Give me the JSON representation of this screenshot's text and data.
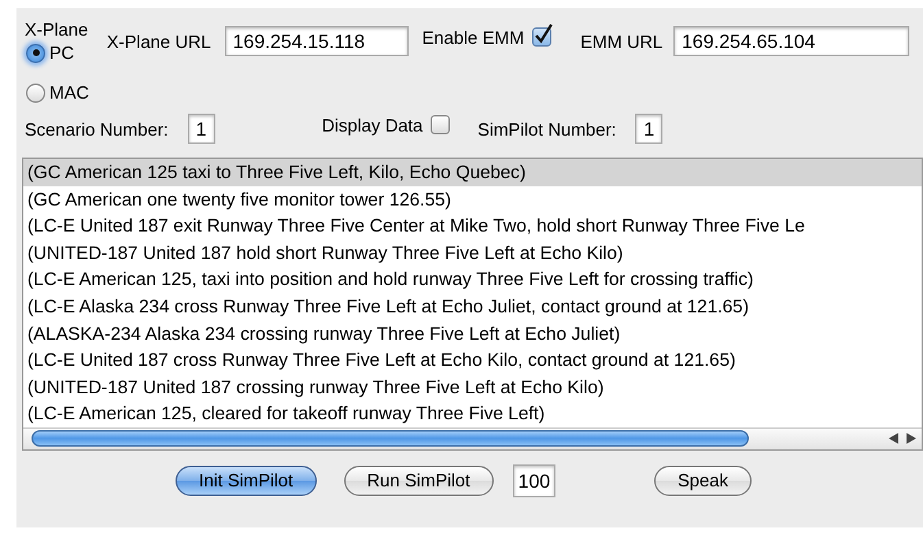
{
  "xplane": {
    "label": "X-Plane",
    "options": [
      {
        "label": "PC",
        "selected": true
      },
      {
        "label": "MAC",
        "selected": false
      }
    ]
  },
  "xplane_url": {
    "label": "X-Plane URL",
    "value": "169.254.15.118"
  },
  "enable_emm": {
    "label": "Enable EMM",
    "checked": true
  },
  "emm_url": {
    "label": "EMM URL",
    "value": "169.254.65.104"
  },
  "scenario_number": {
    "label": "Scenario Number:",
    "value": "1"
  },
  "display_data": {
    "label": "Display Data",
    "checked": false
  },
  "simpilot_number": {
    "label": "SimPilot Number:",
    "value": "1"
  },
  "list": {
    "items": [
      {
        "text": "(GC American 125 taxi to Three Five Left, Kilo, Echo Quebec)",
        "selected": true
      },
      {
        "text": "(GC American one twenty five monitor tower 126.55)",
        "selected": false
      },
      {
        "text": "(LC-E United 187 exit Runway Three Five Center at Mike Two, hold short Runway Three Five Le",
        "selected": false
      },
      {
        "text": "(UNITED-187 United 187 hold short Runway Three Five Left at Echo Kilo)",
        "selected": false
      },
      {
        "text": "(LC-E American 125, taxi into position and hold runway Three Five Left for crossing traffic)",
        "selected": false
      },
      {
        "text": "(LC-E Alaska 234 cross Runway Three Five Left at Echo Juliet, contact ground at 121.65)",
        "selected": false
      },
      {
        "text": "(ALASKA-234 Alaska 234 crossing runway Three Five Left at Echo Juliet)",
        "selected": false
      },
      {
        "text": "(LC-E United 187 cross Runway Three Five Left at Echo Kilo, contact ground at 121.65)",
        "selected": false
      },
      {
        "text": "(UNITED-187 United 187 crossing runway Three Five Left at Echo Kilo)",
        "selected": false
      },
      {
        "text": "(LC-E American 125, cleared for takeoff runway Three Five Left)",
        "selected": false
      }
    ]
  },
  "bottom": [
    {
      "kind": "button",
      "label": "Init SimPilot",
      "default": true
    },
    {
      "kind": "button",
      "label": "Run SimPilot",
      "default": false
    },
    {
      "kind": "field",
      "value": "100"
    },
    {
      "kind": "button",
      "label": "Speak",
      "default": false
    }
  ]
}
